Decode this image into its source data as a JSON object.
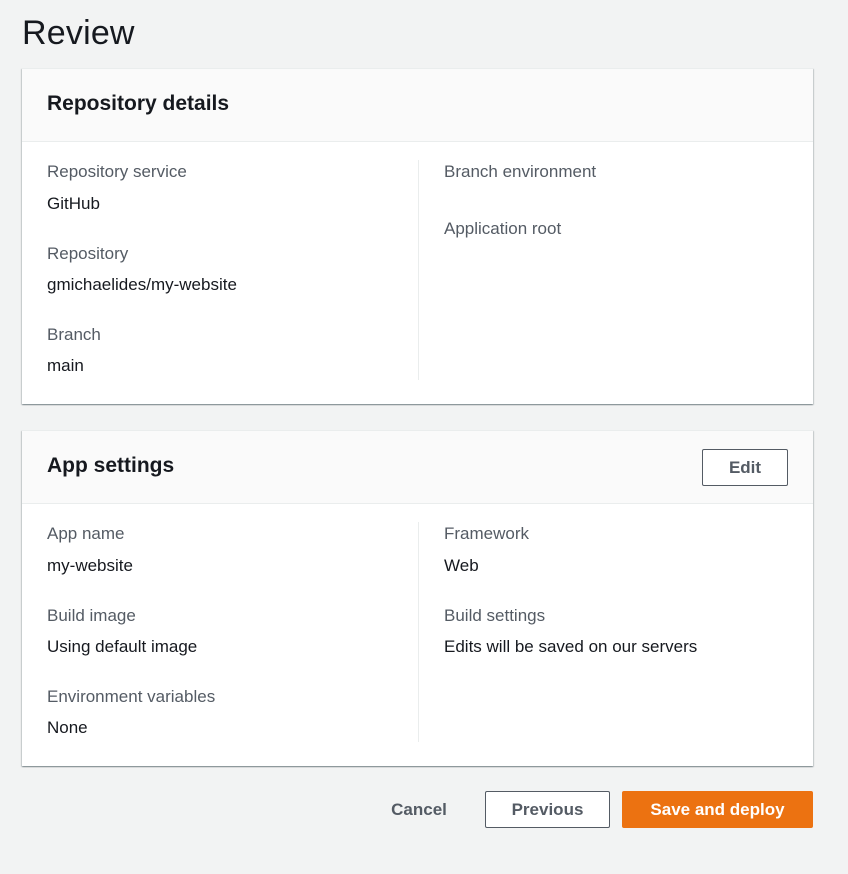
{
  "page": {
    "title": "Review"
  },
  "repository_details": {
    "title": "Repository details",
    "fields_left": [
      {
        "label": "Repository service",
        "value": "GitHub"
      },
      {
        "label": "Repository",
        "value": "gmichaelides/my-website"
      },
      {
        "label": "Branch",
        "value": "main"
      }
    ],
    "fields_right": [
      {
        "label": "Branch environment",
        "value": ""
      },
      {
        "label": "Application root",
        "value": ""
      }
    ]
  },
  "app_settings": {
    "title": "App settings",
    "edit_label": "Edit",
    "fields_left": [
      {
        "label": "App name",
        "value": "my-website"
      },
      {
        "label": "Build image",
        "value": "Using default image"
      },
      {
        "label": "Environment variables",
        "value": "None"
      }
    ],
    "fields_right": [
      {
        "label": "Framework",
        "value": "Web"
      },
      {
        "label": "Build settings",
        "value": "Edits will be saved on our servers"
      }
    ]
  },
  "footer": {
    "cancel_label": "Cancel",
    "previous_label": "Previous",
    "primary_label": "Save and deploy"
  },
  "colors": {
    "primary": "#ec7211",
    "background": "#f2f3f3",
    "panel_header": "#fafafa"
  }
}
